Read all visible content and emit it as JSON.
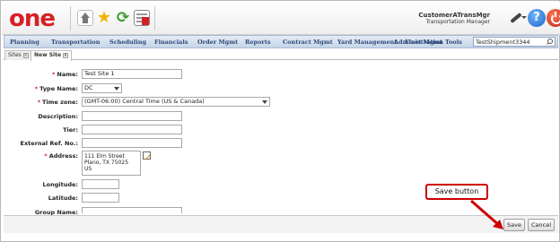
{
  "header": {
    "logo_text": "one",
    "user_name": "CustomerATransMgr",
    "user_role": "Transportation Manager",
    "help_label": "?"
  },
  "nav": {
    "items": [
      "Planning",
      "Transportation",
      "Scheduling",
      "Financials",
      "Order Mgmt",
      "Reports",
      "Contract Mgmt",
      "Yard Management",
      "Fleet Mgmt",
      "Administration",
      "Tools"
    ],
    "search_value": "TestShipment3344"
  },
  "tabs": [
    {
      "label": "Sites",
      "close": "x"
    },
    {
      "label": "New Site",
      "close": "x"
    }
  ],
  "form": {
    "name_label": "Name:",
    "name_value": "Test Site 1",
    "type_label": "Type Name:",
    "type_value": "DC",
    "timezone_label": "Time zone:",
    "timezone_value": "(GMT-06:00) Central Time (US & Canada)",
    "description_label": "Description:",
    "tier_label": "Tier:",
    "extref_label": "External Ref. No.:",
    "address_label": "Address:",
    "address_line1": "111 Elm Street",
    "address_line2": "Plano, TX 75025",
    "address_line3": "US",
    "longitude_label": "Longitude:",
    "latitude_label": "Latitude:",
    "group_label": "Group Name:",
    "required_mark": "*"
  },
  "footer": {
    "save_label": "Save",
    "cancel_label": "Cancel"
  },
  "callout": {
    "text": "Save button",
    "color": "#cc0000"
  }
}
